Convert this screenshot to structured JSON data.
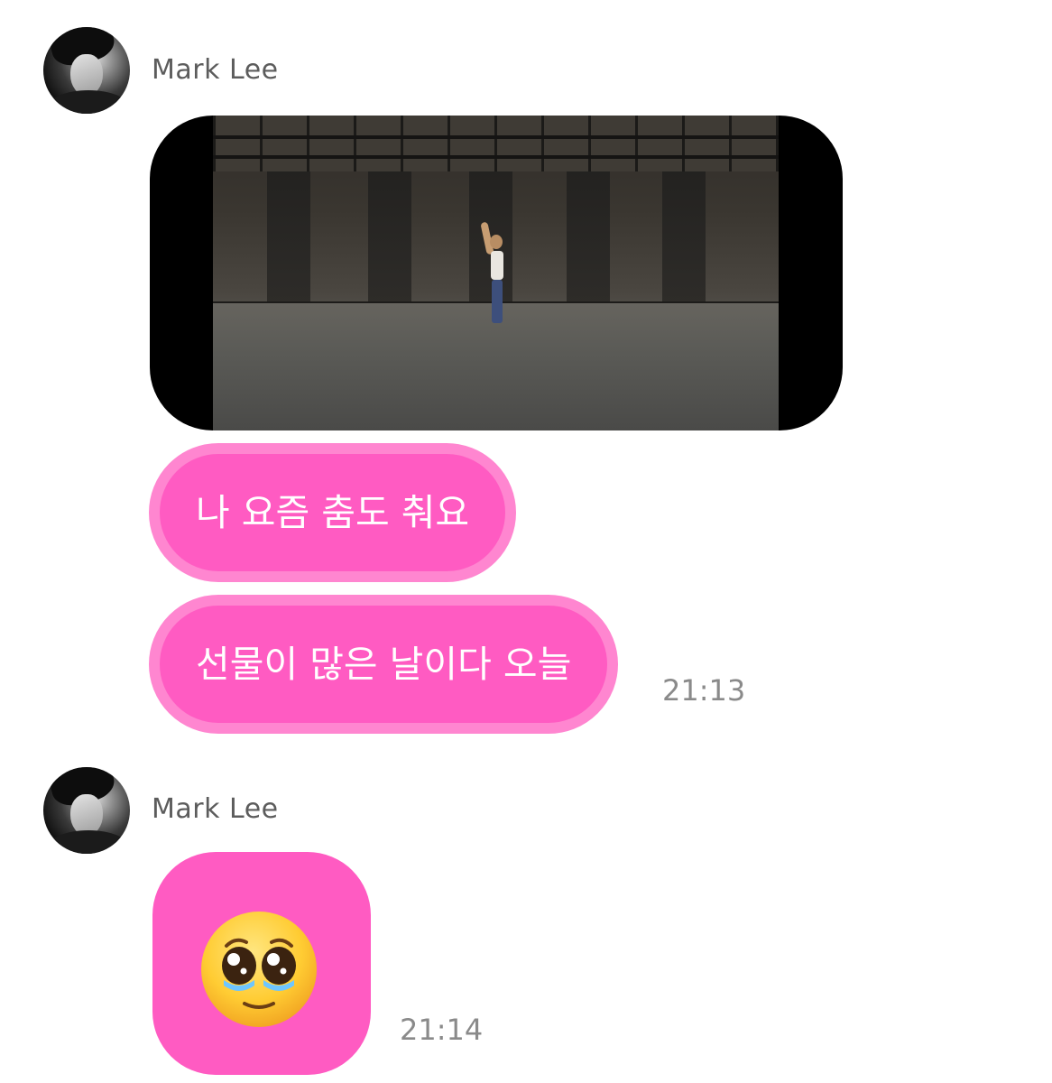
{
  "messages": [
    {
      "sender": "Mark Lee",
      "attachment": "video",
      "texts": [
        "나 요즘 춤도 춰요",
        "선물이 많은 날이다 오늘"
      ],
      "timestamp": "21:13"
    },
    {
      "sender": "Mark Lee",
      "emoji": "pleading-face",
      "timestamp": "21:14"
    }
  ],
  "colors": {
    "bubble": "#ff5bc2",
    "bubble_border": "#ff86d0",
    "name": "#5c5c5c",
    "timestamp": "#8a8a8a"
  }
}
